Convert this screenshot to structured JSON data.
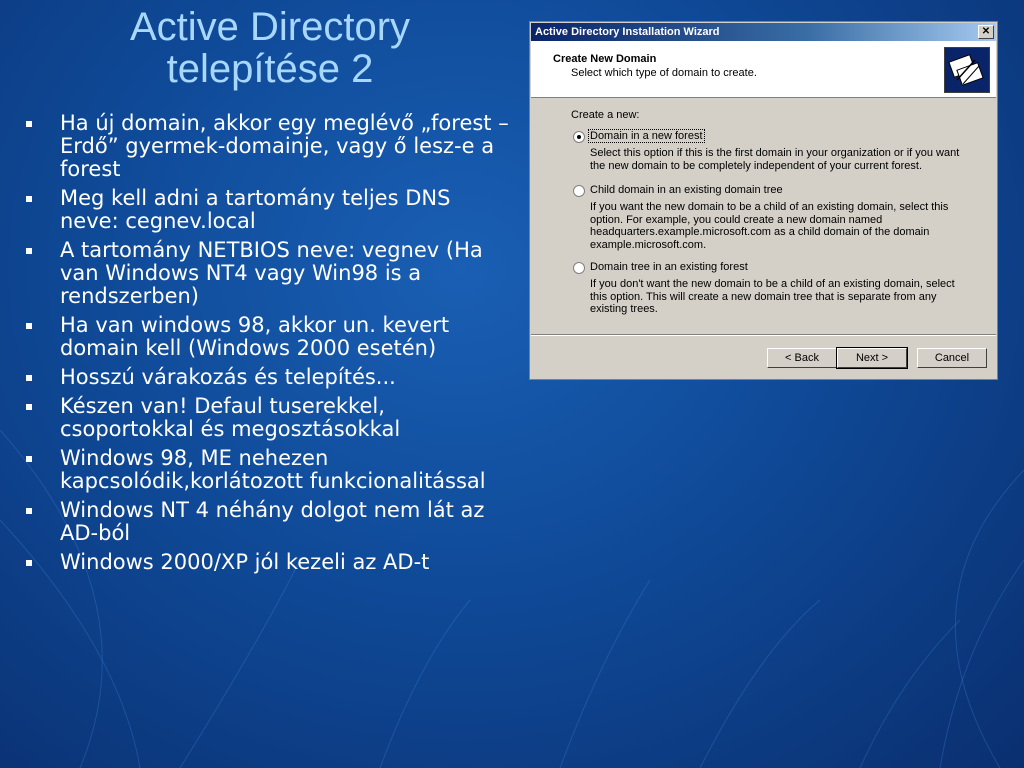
{
  "slide": {
    "title_line1": "Active Directory",
    "title_line2": "telepítése 2",
    "bullets": [
      "Ha új domain, akkor egy meglévő „forest – Erdő” gyermek-domainje, vagy ő lesz-e a forest",
      "Meg kell adni a tartomány teljes DNS neve: cegnev.local",
      "A tartomány NETBIOS neve: vegnev (Ha van Windows NT4 vagy Win98 is a rendszerben)",
      "Ha van windows 98, akkor un. kevert domain kell (Windows 2000 esetén)",
      "Hosszú várakozás és telepítés...",
      "Készen van! Defaul tuserekkel, csoportokkal és megosztásokkal",
      "Windows 98, ME nehezen kapcsolódik,korlátozott funkcionalitással",
      "Windows NT 4 néhány dolgot nem lát az AD-ból",
      "Windows 2000/XP jól kezeli az AD-t"
    ]
  },
  "dialog": {
    "title": "Active Directory Installation Wizard",
    "close_glyph": "✕",
    "header_title": "Create New Domain",
    "header_subtitle": "Select which type of domain to create.",
    "create_label": "Create a new:",
    "options": [
      {
        "label": "Domain in a new forest",
        "desc": "Select this option if this is the first domain in your organization or if you want the new domain to be completely independent of your current forest.",
        "checked": true
      },
      {
        "label": "Child domain in an existing domain tree",
        "desc": "If you want the new domain to be a child of an existing domain, select this option. For example, you could create a new domain named headquarters.example.microsoft.com as a child domain of the domain example.microsoft.com.",
        "checked": false
      },
      {
        "label": "Domain tree in an existing forest",
        "desc": "If you don't want the new domain to be a child of an existing domain, select this option. This will create a new domain tree that is separate from any existing trees.",
        "checked": false
      }
    ],
    "buttons": {
      "back": "< Back",
      "next": "Next >",
      "cancel": "Cancel"
    }
  },
  "colors": {
    "background": "#1a5fb4",
    "title": "#a8d8ff",
    "text": "#ffffff",
    "titlebar": "#0a246a"
  }
}
